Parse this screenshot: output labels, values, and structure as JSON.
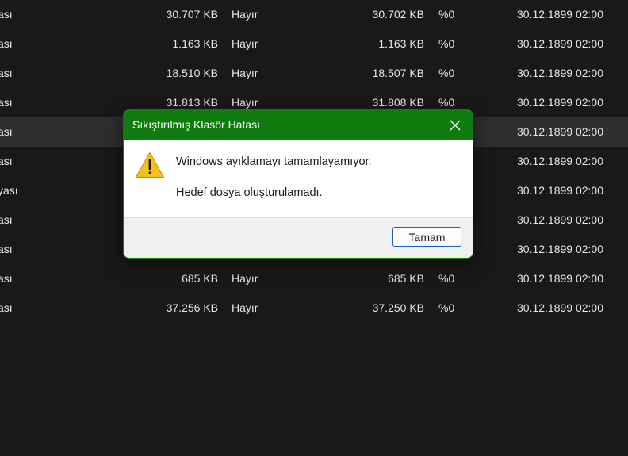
{
  "files": {
    "rows": [
      {
        "type": "ası",
        "packed": "30.707 KB",
        "protected": "Hayır",
        "size": "30.702 KB",
        "ratio": "%0",
        "date": "30.12.1899 02:00",
        "selected": false
      },
      {
        "type": "ası",
        "packed": "1.163 KB",
        "protected": "Hayır",
        "size": "1.163 KB",
        "ratio": "%0",
        "date": "30.12.1899 02:00",
        "selected": false
      },
      {
        "type": "ası",
        "packed": "18.510 KB",
        "protected": "Hayır",
        "size": "18.507 KB",
        "ratio": "%0",
        "date": "30.12.1899 02:00",
        "selected": false
      },
      {
        "type": "ası",
        "packed": "31.813 KB",
        "protected": "Hayır",
        "size": "31.808 KB",
        "ratio": "%0",
        "date": "30.12.1899 02:00",
        "selected": false
      },
      {
        "type": "ası",
        "packed": "",
        "protected": "",
        "size": "",
        "ratio": "",
        "date": "30.12.1899 02:00",
        "selected": true
      },
      {
        "type": "ası",
        "packed": "",
        "protected": "",
        "size": "",
        "ratio": "",
        "date": "30.12.1899 02:00",
        "selected": false
      },
      {
        "type": "yası",
        "packed": "",
        "protected": "",
        "size": "",
        "ratio": "",
        "date": "30.12.1899 02:00",
        "selected": false
      },
      {
        "type": "ası",
        "packed": "",
        "protected": "",
        "size": "",
        "ratio": "",
        "date": "30.12.1899 02:00",
        "selected": false
      },
      {
        "type": "ası",
        "packed": "",
        "protected": "",
        "size": "",
        "ratio": "",
        "date": "30.12.1899 02:00",
        "selected": false
      },
      {
        "type": "ası",
        "packed": "685 KB",
        "protected": "Hayır",
        "size": "685 KB",
        "ratio": "%0",
        "date": "30.12.1899 02:00",
        "selected": false
      },
      {
        "type": "ası",
        "packed": "37.256 KB",
        "protected": "Hayır",
        "size": "37.250 KB",
        "ratio": "%0",
        "date": "30.12.1899 02:00",
        "selected": false
      }
    ]
  },
  "dialog": {
    "title": "Sıkıştırılmış Klasör Hatası",
    "close_icon": "close-icon",
    "warning_icon": "warning-icon",
    "message_line1": "Windows ayıklamayı tamamlayamıyor.",
    "message_line2": "Hedef dosya oluşturulamadı.",
    "ok_label": "Tamam",
    "accent_color": "#107c10",
    "button_border_color": "#1c63b8"
  }
}
